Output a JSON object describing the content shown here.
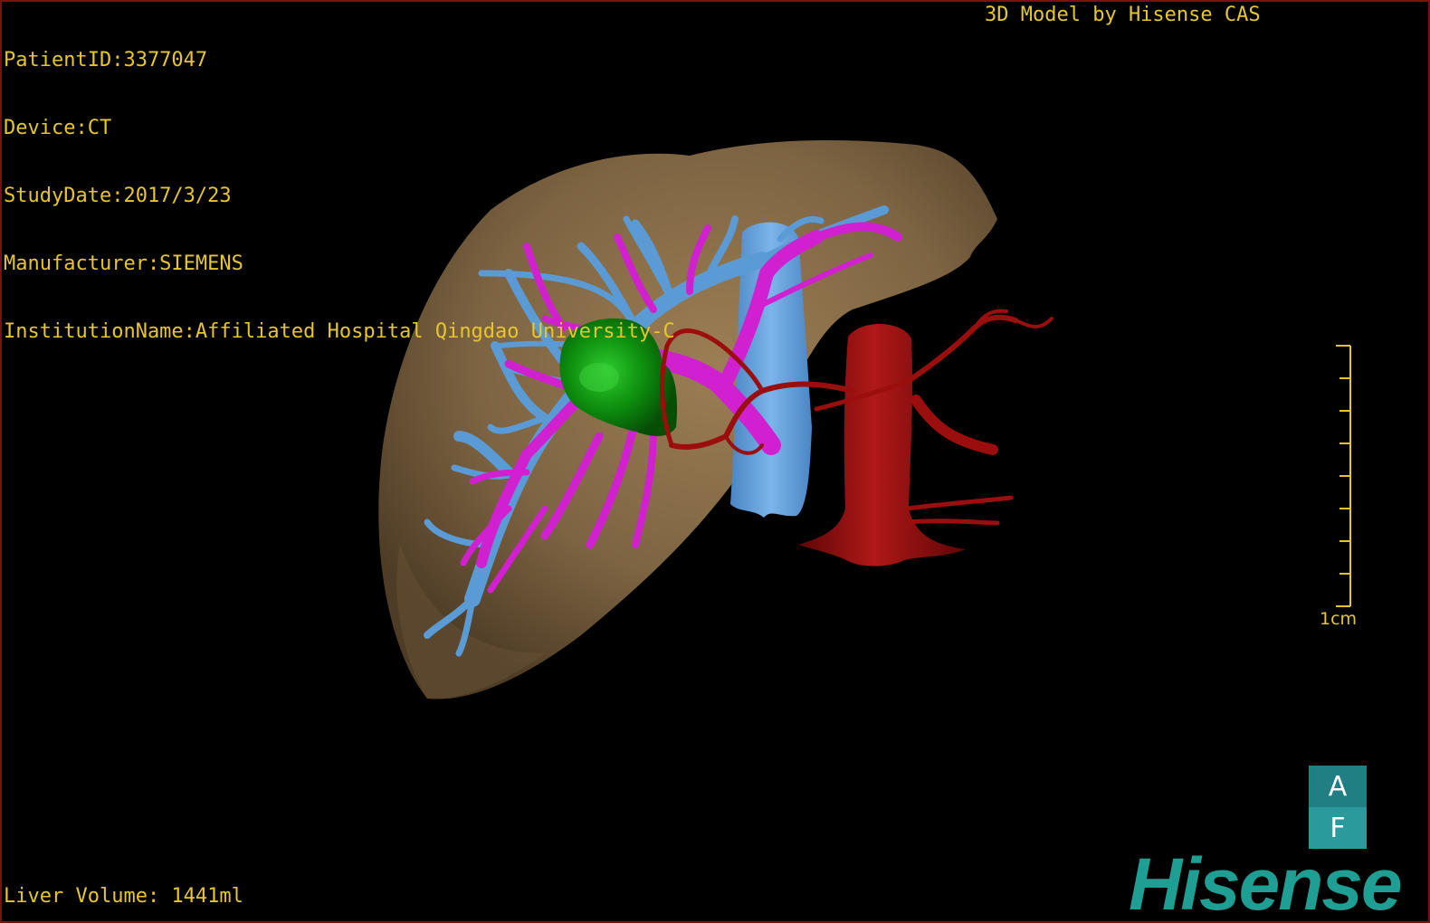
{
  "patient_info": {
    "patient_id": "PatientID:3377047",
    "device": "Device:CT",
    "study_date": "StudyDate:2017/3/23",
    "manufacturer": "Manufacturer:SIEMENS",
    "institution": "InstitutionName:Affiliated Hospital Qingdao University-C"
  },
  "credit": "3D Model by Hisense CAS",
  "liver_volume": "Liver Volume: 1441ml",
  "scale_bar": {
    "label": "1cm"
  },
  "orientation_cube": {
    "top_label": "A",
    "bottom_label": "F"
  },
  "logo": "Hisense",
  "colors": {
    "overlay_text": "#e6c62e",
    "liver": "#8a6f4a",
    "hepatic_vein": "#5b9bd5",
    "portal_vein": "#d020d0",
    "tumor": "#0c7a0c",
    "artery_aorta": "#9a0e0e",
    "logo": "#1f9f94"
  }
}
